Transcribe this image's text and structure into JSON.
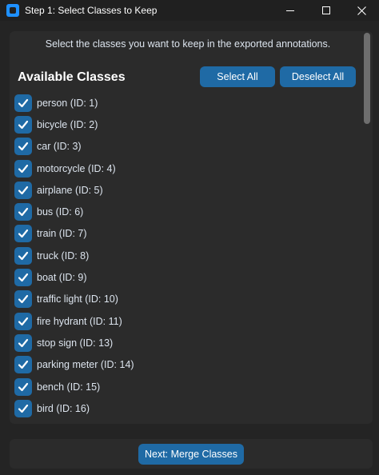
{
  "window": {
    "title": "Step 1: Select Classes to Keep"
  },
  "instruction": "Select the classes you want to keep in the exported annotations.",
  "section_title": "Available Classes",
  "buttons": {
    "select_all": "Select All",
    "deselect_all": "Deselect All",
    "next": "Next: Merge Classes"
  },
  "classes": [
    {
      "label": "person (ID: 1)",
      "checked": true
    },
    {
      "label": "bicycle (ID: 2)",
      "checked": true
    },
    {
      "label": "car (ID: 3)",
      "checked": true
    },
    {
      "label": "motorcycle (ID: 4)",
      "checked": true
    },
    {
      "label": "airplane (ID: 5)",
      "checked": true
    },
    {
      "label": "bus (ID: 6)",
      "checked": true
    },
    {
      "label": "train (ID: 7)",
      "checked": true
    },
    {
      "label": "truck (ID: 8)",
      "checked": true
    },
    {
      "label": "boat (ID: 9)",
      "checked": true
    },
    {
      "label": "traffic light (ID: 10)",
      "checked": true
    },
    {
      "label": "fire hydrant (ID: 11)",
      "checked": true
    },
    {
      "label": "stop sign (ID: 13)",
      "checked": true
    },
    {
      "label": "parking meter (ID: 14)",
      "checked": true
    },
    {
      "label": "bench (ID: 15)",
      "checked": true
    },
    {
      "label": "bird (ID: 16)",
      "checked": true
    }
  ],
  "colors": {
    "accent": "#1f6aa5",
    "background": "#242424",
    "panel": "#2b2b2b"
  }
}
